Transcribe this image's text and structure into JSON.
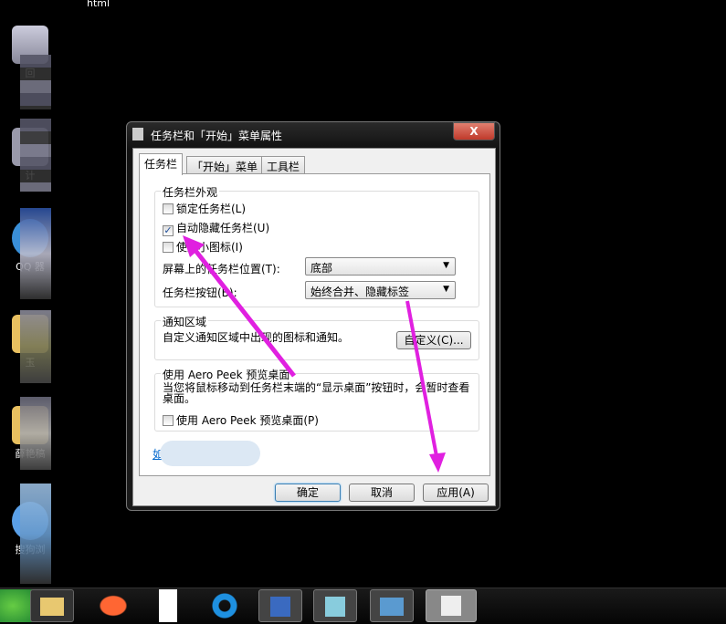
{
  "desktop": {
    "top_text": "html",
    "icons": [
      "回",
      "计",
      "QQ",
      "器",
      "玉",
      "薛艳",
      "稿",
      "搜狗",
      "浏"
    ]
  },
  "dialog": {
    "title": "任务栏和「开始」菜单属性",
    "close": "X",
    "tabs": [
      "任务栏",
      "「开始」菜单",
      "工具栏"
    ],
    "appearance": {
      "label": "任务栏外观",
      "lock": "锁定任务栏(L)",
      "autohide": "自动隐藏任务栏(U)",
      "autohide_checked": true,
      "small_icons": "使用小图标(I)",
      "position_label": "屏幕上的任务栏位置(T):",
      "position_value": "底部",
      "buttons_label": "任务栏按钮(B):",
      "buttons_value": "始终合并、隐藏标签"
    },
    "notify": {
      "label": "通知区域",
      "desc": "自定义通知区域中出现的图标和通知。",
      "customize": "自定义(C)..."
    },
    "peek": {
      "label": "使用 Aero Peek 预览桌面",
      "desc": "当您将鼠标移动到任务栏末端的“显示桌面”按钮时，会暂时查看桌面。",
      "checkbox": "使用 Aero Peek 预览桌面(P)"
    },
    "link": "如",
    "ok": "确定",
    "cancel": "取消",
    "apply": "应用(A)"
  },
  "taskbar": {
    "items": [
      "security-icon",
      "explorer-icon",
      "firefox-icon",
      "file-icon",
      "qq-browser-icon",
      "word-icon",
      "notepad-icon",
      "photo-viewer-icon",
      "properties-icon"
    ]
  },
  "colors": {
    "arrow": "#e020e0"
  }
}
